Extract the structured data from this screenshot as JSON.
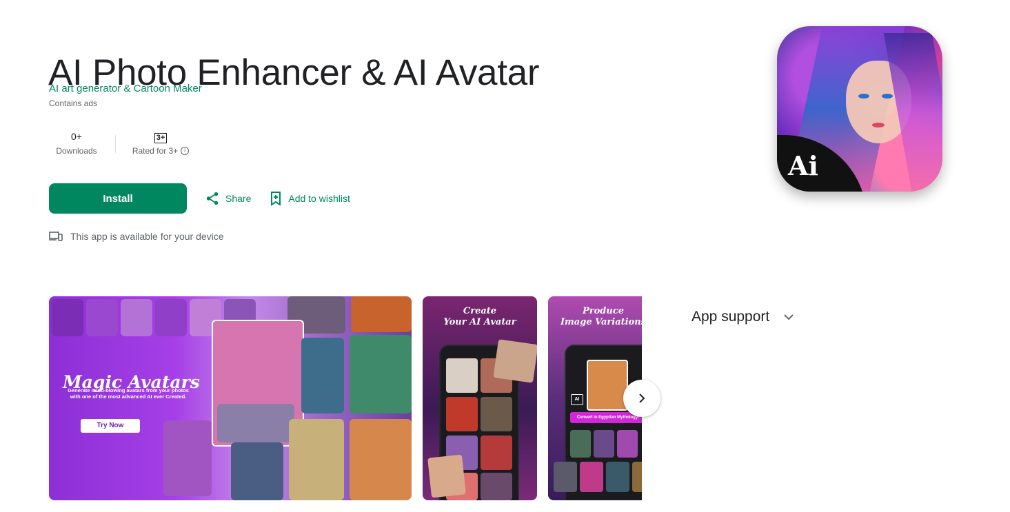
{
  "app": {
    "title": "AI Photo Enhancer & AI Avatar",
    "developer": "AI art generator & Cartoon Maker",
    "ads_notice": "Contains ads",
    "icon_text": "Ai"
  },
  "stats": {
    "downloads_value": "0+",
    "downloads_label": "Downloads",
    "rating_badge": "3+",
    "rating_label": "Rated for 3+"
  },
  "actions": {
    "install": "Install",
    "share": "Share",
    "wishlist": "Add to wishlist"
  },
  "device_note": "This app is available for your device",
  "screenshots": {
    "shot1": {
      "headline": "Magic Avatars",
      "subtext": "Generate mind-blowing avatars from your photos with one of the most advanced AI ever Created.",
      "button": "Try Now"
    },
    "shot2": {
      "headline": "Create\nYour AI Avatar"
    },
    "shot3": {
      "headline": "Produce\nImage Variations",
      "ai_tag": "AI",
      "convert_pill": "Convert in Egyptian Mythology!"
    }
  },
  "sidebar": {
    "app_support": "App support"
  },
  "colors": {
    "brand_green": "#01875f",
    "text_primary": "#202124",
    "text_secondary": "#5f6368"
  },
  "icons": [
    "share-icon",
    "bookmark-add-icon",
    "devices-icon",
    "info-icon",
    "chevron-right-icon",
    "chevron-down-icon"
  ]
}
